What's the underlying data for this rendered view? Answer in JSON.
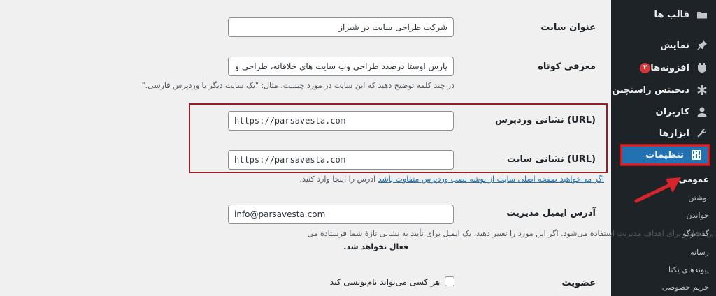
{
  "sidebar": {
    "items": [
      {
        "label": "قالب ها",
        "icon": "appearance-icon"
      },
      {
        "label": "نمایش",
        "icon": "pin-icon"
      },
      {
        "label": "افزونه‌ها",
        "icon": "plugin-icon",
        "badge": "۲"
      },
      {
        "label": "دیجیتس راستچین",
        "icon": "asterisk-icon"
      },
      {
        "label": "کاربران",
        "icon": "user-icon"
      },
      {
        "label": "ابزارها",
        "icon": "wrench-icon"
      },
      {
        "label": "تنظیمات",
        "icon": "settings-icon"
      }
    ],
    "submenu": [
      "عمومی",
      "نوشتن",
      "خواندن",
      "گفت‌وگو",
      "رسانه",
      "پیوندهای یکتا",
      "حریم خصوصی"
    ]
  },
  "form": {
    "site_title": {
      "label": "عنوان سایت",
      "value": "شرکت طراحی سایت در شیراز"
    },
    "tagline": {
      "label": "معرفی کوتاه",
      "value": "پارس اوستا درصدد طراحی وب سایت های خلاقانه، طراحی و",
      "description": "در چند کلمه توضیح دهید که این سایت در مورد چیست. مثال: \"یک سایت دیگر با وردپرس فارسی.\""
    },
    "wp_url": {
      "label": "نشانی وردپرس (URL)",
      "value": "https://parsavesta.com"
    },
    "site_url": {
      "label": "نشانی سایت (URL)",
      "value": "https://parsavesta.com",
      "description_link": "اگر می‌خواهید صفحه اصلی سایت از پوشه نصب وردپرس متفاوت باشد",
      "description_rest": " آدرس را اینجا وارد کنید."
    },
    "admin_email": {
      "label": "آدرس ایمیل مدیریت",
      "value": "info@parsavesta.com",
      "description_line1": "این نشانی برای اهداف مدیریت استفاده می‌شود. اگر این مورد را تغییر دهید، یک ایمیل برای تأیید به نشانی تازهٔ شما فرستاده می",
      "description_line2": "فعال نخواهد شد."
    },
    "membership": {
      "label": "عضویت",
      "checkbox_label": "هر کسی می‌تواند نام‌نویسی کند",
      "checked": false
    }
  },
  "colors": {
    "sidebar_bg": "#1d2327",
    "accent": "#2271b1",
    "highlight_border": "#9b1c20",
    "arrow": "#d7262b"
  }
}
